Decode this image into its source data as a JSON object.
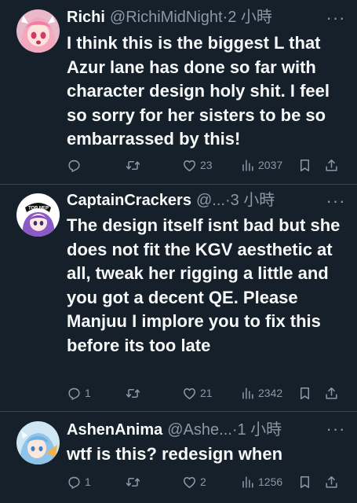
{
  "tweets": [
    {
      "name": "Richi",
      "handle": "@RichiMidNight",
      "time": "·2 小時",
      "text": "I think this is the biggest L that Azur lane has done so far with character design holy shit. I feel so sorry for her sisters to be so embarrassed by this!",
      "replies": "",
      "retweets": "",
      "likes": "23",
      "views": "2037"
    },
    {
      "name": "CaptainCrackers",
      "handle": "@...",
      "time": "·3 小時",
      "text": "The design itself isnt bad but she does not fit the KGV aesthetic at all, tweak her rigging a little and you got a decent QE. Please Manjuu I implore you to fix this before its too late",
      "replies": "1",
      "retweets": "",
      "likes": "21",
      "views": "2342"
    },
    {
      "name": "AshenAnima",
      "handle": "@Ashe...",
      "time": "·1 小時",
      "text": "wtf is this? redesign when",
      "replies": "1",
      "retweets": "",
      "likes": "2",
      "views": "1256"
    }
  ],
  "avatar_badge": "TOP NEP",
  "colors": {
    "background": "#15202b",
    "text": "#f7f9f9",
    "secondary": "#8b98a5",
    "divider": "#38444d"
  }
}
